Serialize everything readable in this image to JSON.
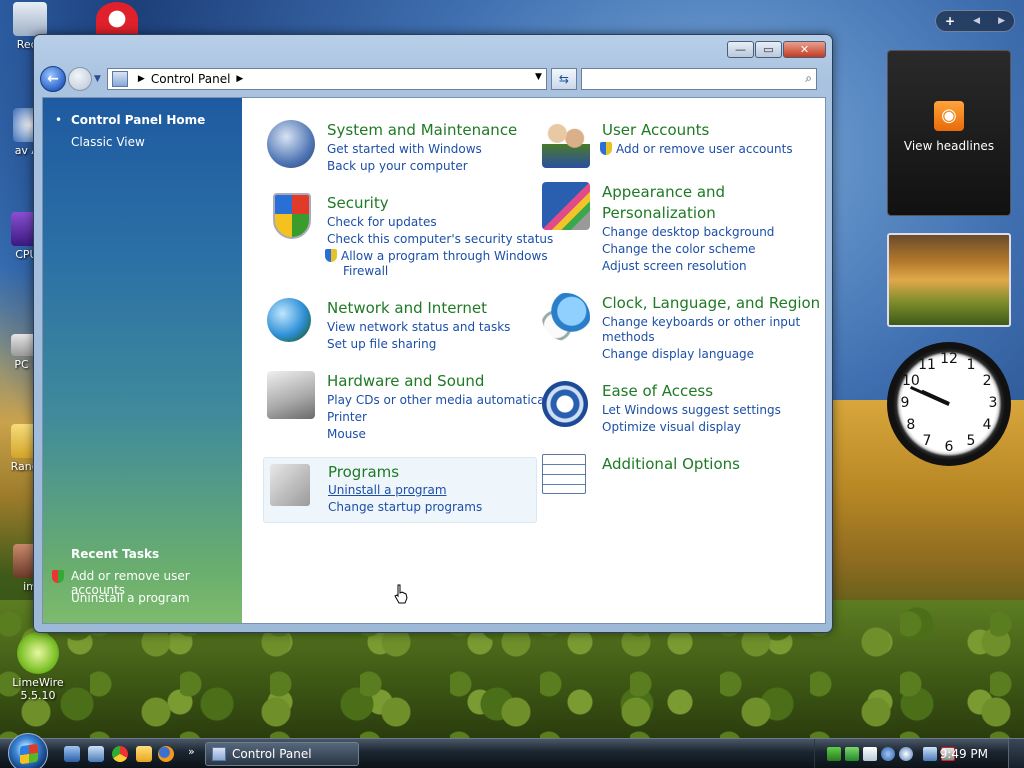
{
  "desktop": {
    "icons": [
      {
        "label": "Recy"
      },
      {
        "label": "av Anti"
      },
      {
        "label": "CPUI"
      },
      {
        "label": "PC M"
      },
      {
        "label": "Rando"
      },
      {
        "label": "im"
      },
      {
        "label": "LimeWire 5.5.10"
      }
    ]
  },
  "sidebar": {
    "nav": {
      "add": "+",
      "prev": "◀",
      "next": "▶"
    },
    "feed": {
      "label": "View headlines",
      "icon": "rss-icon"
    },
    "clock_time": {
      "hour": 9,
      "minute": 49
    }
  },
  "window": {
    "title_buttons": {
      "minimize": "—",
      "maximize": "▭",
      "close": "✕"
    },
    "address": {
      "breadcrumb": "Control Panel",
      "separator": "▶"
    },
    "search": {
      "placeholder": "",
      "value": ""
    },
    "left_pane": {
      "home": "Control Panel Home",
      "classic": "Classic View",
      "recent_tasks_heading": "Recent Tasks",
      "recent_tasks": [
        "Add or remove user accounts",
        "Uninstall a program"
      ]
    },
    "categories": {
      "system": {
        "title": "System and Maintenance",
        "links": [
          "Get started with Windows",
          "Back up your computer"
        ]
      },
      "security": {
        "title": "Security",
        "links": [
          "Check for updates",
          "Check this computer's security status",
          "Allow a program through Windows",
          "Firewall"
        ]
      },
      "network": {
        "title": "Network and Internet",
        "links": [
          "View network status and tasks",
          "Set up file sharing"
        ]
      },
      "hardware": {
        "title": "Hardware and Sound",
        "links": [
          "Play CDs or other media automatically",
          "Printer",
          "Mouse"
        ]
      },
      "programs": {
        "title": "Programs",
        "links": [
          "Uninstall a program",
          "Change startup programs"
        ]
      },
      "users": {
        "title": "User Accounts",
        "links": [
          "Add or remove user accounts"
        ]
      },
      "appearance": {
        "title_line1": "Appearance and",
        "title_line2": "Personalization",
        "links": [
          "Change desktop background",
          "Change the color scheme",
          "Adjust screen resolution"
        ]
      },
      "clock": {
        "title": "Clock, Language, and Region",
        "links": [
          "Change keyboards or other input",
          "methods",
          "Change display language"
        ]
      },
      "ease": {
        "title": "Ease of Access",
        "links": [
          "Let Windows suggest settings",
          "Optimize visual display"
        ]
      },
      "additional": {
        "title": "Additional Options"
      }
    }
  },
  "taskbar": {
    "task_label": "Control Panel",
    "clock": "9:49 PM",
    "overflow": "»"
  }
}
